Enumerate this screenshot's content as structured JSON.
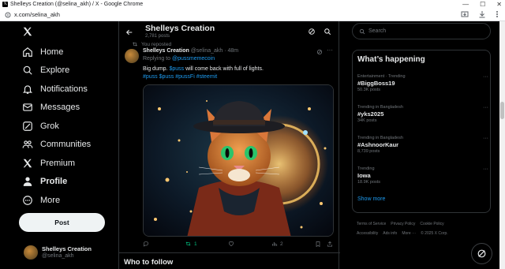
{
  "browser": {
    "window_title": "Shelleys Creation (@selina_akh) / X - Google Chrome",
    "url": "x.com/selina_akh"
  },
  "sidebar": {
    "items": [
      {
        "label": "Home",
        "icon": "home-icon"
      },
      {
        "label": "Explore",
        "icon": "search-icon"
      },
      {
        "label": "Notifications",
        "icon": "bell-icon"
      },
      {
        "label": "Messages",
        "icon": "envelope-icon"
      },
      {
        "label": "Grok",
        "icon": "grok-icon"
      },
      {
        "label": "Communities",
        "icon": "people-icon"
      },
      {
        "label": "Premium",
        "icon": "x-logo-icon"
      },
      {
        "label": "Profile",
        "icon": "person-icon"
      },
      {
        "label": "More",
        "icon": "more-circle-icon"
      }
    ],
    "post_button": "Post",
    "account": {
      "name": "Shelleys Creation",
      "handle": "@selina_akh"
    }
  },
  "profile_header": {
    "name": "Shelleys Creation",
    "posts_count": "2,781 posts"
  },
  "tweet": {
    "repost_label": "You reposted",
    "author_name": "Shelleys Creation",
    "author_meta": "@selina_akh · 48m",
    "replying_prefix": "Replying to ",
    "replying_to": "@pussmemecoin",
    "text_start": "Big dump. ",
    "text_link": "$puss",
    "text_end": " will come back with full of lights.",
    "hashtags": "#puss $puss #pussFi #steemit",
    "actions": {
      "replies": "",
      "reposts": "1",
      "likes": "",
      "views": "2"
    }
  },
  "who_to_follow": "Who to follow",
  "right": {
    "search_placeholder": "Search",
    "happening_title": "What’s happening",
    "trends": [
      {
        "category": "Entertainment · Trending",
        "name": "#BiggBoss19",
        "posts": "50.3K posts"
      },
      {
        "category": "Trending in Bangladesh",
        "name": "#yks2025",
        "posts": "34K posts"
      },
      {
        "category": "Trending in Bangladesh",
        "name": "#AshnoorKaur",
        "posts": "8,739 posts"
      },
      {
        "category": "Trending",
        "name": "Iowa",
        "posts": "18.9K posts"
      }
    ],
    "show_more": "Show more",
    "footer_links": [
      "Terms of Service",
      "Privacy Policy",
      "Cookie Policy",
      "Accessibility",
      "Ads info",
      "More ···",
      "© 2025 X Corp."
    ]
  },
  "colors": {
    "accent": "#1d9bf0",
    "repost_green": "#00ba7c",
    "background": "#000000",
    "border": "#2f3336",
    "muted": "#71767b"
  }
}
